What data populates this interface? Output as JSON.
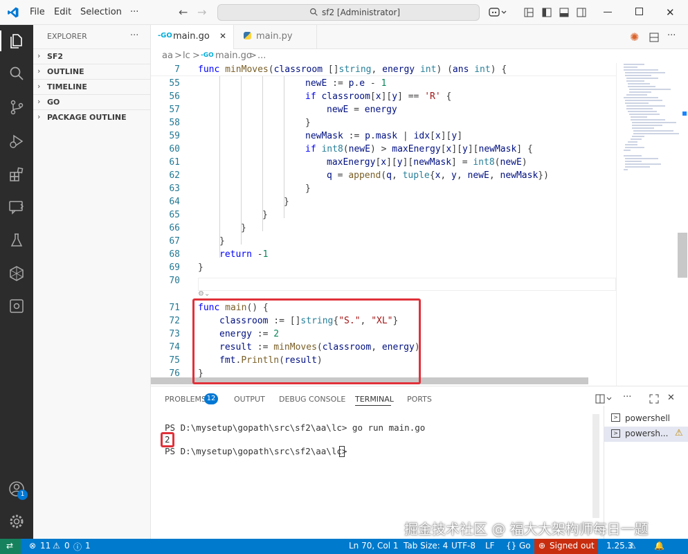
{
  "titlebar": {
    "menu": [
      "File",
      "Edit",
      "Selection"
    ],
    "more": "···",
    "search": "sf2 [Administrator]"
  },
  "sidebar": {
    "title": "EXPLORER",
    "more": "···",
    "sections": [
      "SF2",
      "OUTLINE",
      "TIMELINE",
      "GO",
      "PACKAGE OUTLINE"
    ]
  },
  "tabs": [
    {
      "label": "main.go",
      "icon": "go-file-icon",
      "active": true
    },
    {
      "label": "main.py",
      "icon": "python-file-icon",
      "active": false
    }
  ],
  "breadcrumb": [
    "aa",
    ">",
    "lc",
    ">",
    "main.go",
    ">",
    "..."
  ],
  "editor": {
    "sticky": {
      "num": "7",
      "code": "func minMoves(classroom []string, energy int) (ans int) {"
    },
    "lines": [
      {
        "num": "55",
        "indent": 5,
        "code": "newE := p.e - 1"
      },
      {
        "num": "56",
        "indent": 5,
        "code": "if classroom[x][y] == 'R' {"
      },
      {
        "num": "57",
        "indent": 6,
        "code": "newE = energy"
      },
      {
        "num": "58",
        "indent": 5,
        "code": "}"
      },
      {
        "num": "59",
        "indent": 5,
        "code": "newMask := p.mask | idx[x][y]"
      },
      {
        "num": "60",
        "indent": 5,
        "code": "if int8(newE) > maxEnergy[x][y][newMask] {"
      },
      {
        "num": "61",
        "indent": 6,
        "code": "maxEnergy[x][y][newMask] = int8(newE)"
      },
      {
        "num": "62",
        "indent": 6,
        "code": "q = append(q, tuple{x, y, newE, newMask})"
      },
      {
        "num": "63",
        "indent": 5,
        "code": "}"
      },
      {
        "num": "64",
        "indent": 4,
        "code": "}"
      },
      {
        "num": "65",
        "indent": 3,
        "code": "}"
      },
      {
        "num": "66",
        "indent": 2,
        "code": "}"
      },
      {
        "num": "67",
        "indent": 1,
        "code": "}"
      },
      {
        "num": "68",
        "indent": 1,
        "code": "return -1"
      },
      {
        "num": "69",
        "indent": 0,
        "code": "}"
      },
      {
        "num": "70",
        "indent": 0,
        "code": ""
      }
    ],
    "main_lines": [
      {
        "num": "71",
        "indent": 0,
        "code": "func main() {"
      },
      {
        "num": "72",
        "indent": 1,
        "code": "classroom := []string{\"S.\", \"XL\"}"
      },
      {
        "num": "73",
        "indent": 1,
        "code": "energy := 2"
      },
      {
        "num": "74",
        "indent": 1,
        "code": "result := minMoves(classroom, energy)"
      },
      {
        "num": "75",
        "indent": 1,
        "code": "fmt.Println(result)"
      },
      {
        "num": "76",
        "indent": 0,
        "code": "}"
      }
    ]
  },
  "panel": {
    "tabs": [
      "PROBLEMS",
      "OUTPUT",
      "DEBUG CONSOLE",
      "TERMINAL",
      "PORTS"
    ],
    "problems_badge": "12",
    "active_tab": "TERMINAL",
    "terminal": [
      "PS D:\\mysetup\\gopath\\src\\sf2\\aa\\lc> go run main.go",
      "2",
      "PS D:\\mysetup\\gopath\\src\\sf2\\aa\\lc> "
    ],
    "sessions": [
      "powershell",
      "powersh..."
    ]
  },
  "statusbar": {
    "errors": "11",
    "warnings": "0",
    "info": "1",
    "position": "Ln 70, Col 1",
    "tab_size": "Tab Size: 4",
    "encoding": "UTF-8",
    "eol": "LF",
    "language": "Go",
    "account": "Signed out",
    "go_version": "1.25.3"
  },
  "accounts_badge": "1",
  "watermark": "掘金技术社区 @ 福大大架构师每日一题",
  "colors": {
    "accent": "#007acc",
    "activity": "#2c2c2c",
    "highlight": "#e0313a"
  }
}
